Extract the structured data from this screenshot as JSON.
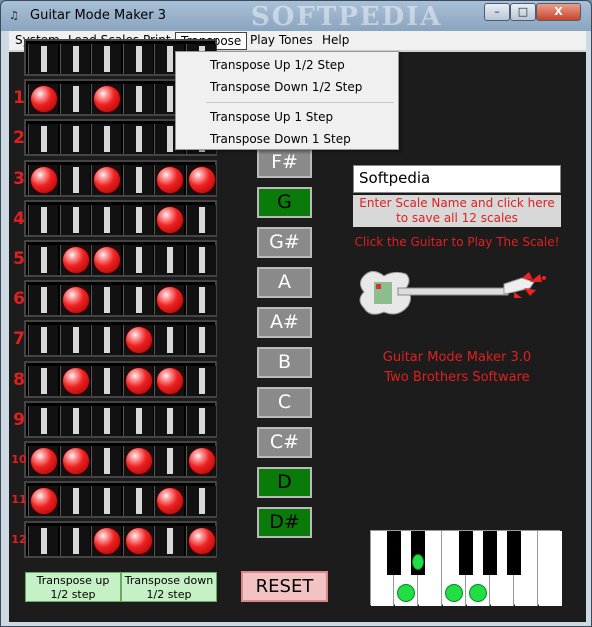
{
  "window": {
    "title": "Guitar Mode Maker 3",
    "watermark": "SOFTPEDIA",
    "min_label": "–",
    "max_label": "□",
    "close_label": "X"
  },
  "menu": [
    "System",
    "Load Scales",
    "Print",
    "Transpose",
    "Play Tones",
    "Help"
  ],
  "transpose_menu": [
    "Transpose Up 1/2 Step",
    "Transpose Down 1/2 Step",
    "Transpose Up 1 Step",
    "Transpose Down 1 Step"
  ],
  "fretboard": {
    "row_numbers": [
      "1",
      "2",
      "3",
      "4",
      "5",
      "6",
      "7",
      "8",
      "9",
      "10",
      "11",
      "12"
    ],
    "rows": [
      [
        0,
        0,
        0,
        0,
        0,
        0
      ],
      [
        1,
        0,
        1,
        0,
        0,
        0
      ],
      [
        0,
        0,
        0,
        0,
        0,
        0
      ],
      [
        1,
        0,
        1,
        0,
        1,
        1
      ],
      [
        0,
        0,
        0,
        0,
        1,
        0
      ],
      [
        0,
        1,
        1,
        0,
        0,
        0
      ],
      [
        0,
        1,
        0,
        0,
        1,
        0
      ],
      [
        0,
        0,
        0,
        1,
        0,
        0
      ],
      [
        0,
        1,
        0,
        1,
        1,
        0
      ],
      [
        0,
        0,
        0,
        0,
        0,
        0
      ],
      [
        1,
        1,
        0,
        1,
        0,
        1
      ],
      [
        1,
        0,
        0,
        0,
        1,
        0
      ],
      [
        0,
        0,
        1,
        1,
        0,
        1
      ]
    ]
  },
  "notes": [
    {
      "label": "F#",
      "state": "grey"
    },
    {
      "label": "G",
      "state": "green"
    },
    {
      "label": "G#",
      "state": "grey"
    },
    {
      "label": "A",
      "state": "grey"
    },
    {
      "label": "A#",
      "state": "grey"
    },
    {
      "label": "B",
      "state": "grey"
    },
    {
      "label": "C",
      "state": "grey"
    },
    {
      "label": "C#",
      "state": "grey"
    },
    {
      "label": "D",
      "state": "green"
    },
    {
      "label": "D#",
      "state": "green"
    }
  ],
  "scale_name_value": "Softpedia",
  "save_hint": "Enter Scale Name and click here\nto save all 12 scales",
  "play_hint": "Click the Guitar to Play The Scale!",
  "about_line1": "Guitar Mode Maker 3.0",
  "about_line2": "Two Brothers Software",
  "transpose_up_btn": "Transpose up\n1/2 step",
  "transpose_down_btn": "Transpose down\n1/2 step",
  "reset_label": "RESET",
  "colors": {
    "note_active": "#0a7a0a",
    "note_inactive": "#8a8a8a",
    "accent_red": "#e02020",
    "dot_green": "#22dd44"
  }
}
